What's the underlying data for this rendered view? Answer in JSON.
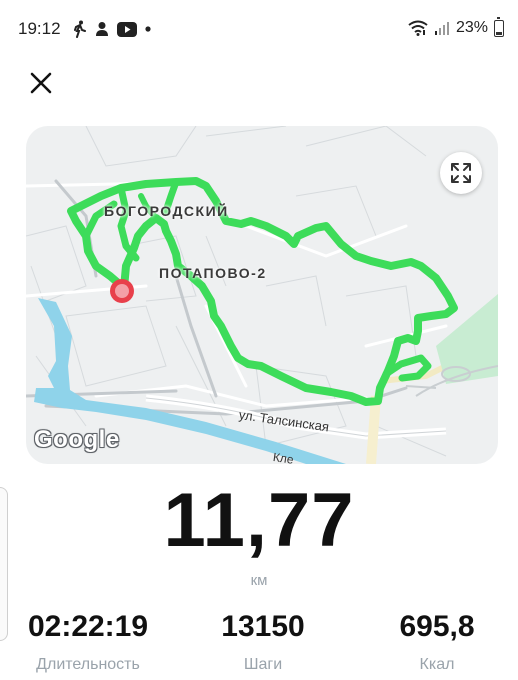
{
  "status_bar": {
    "time": "19:12",
    "battery": "23%",
    "left_icons": [
      "walking-icon",
      "person-icon",
      "youtube-icon",
      "dot-icon"
    ],
    "right_icons": [
      "wifi-icon",
      "signal-icon",
      "battery-icon"
    ]
  },
  "map": {
    "labels": {
      "district_1": "БОГОРОДСКИЙ",
      "district_2": "ПОТАПОВО-2",
      "street": "ул. Талсинская",
      "street_partial": "Кле"
    },
    "attribution": "Google",
    "route_color": "#3ddc5a",
    "marker_color": "#e8404b"
  },
  "summary": {
    "distance": "11,77",
    "distance_unit": "км"
  },
  "stats": [
    {
      "value": "02:22:19",
      "label": "Длительность"
    },
    {
      "value": "13150",
      "label": "Шаги"
    },
    {
      "value": "695,8",
      "label": "Ккал"
    }
  ]
}
